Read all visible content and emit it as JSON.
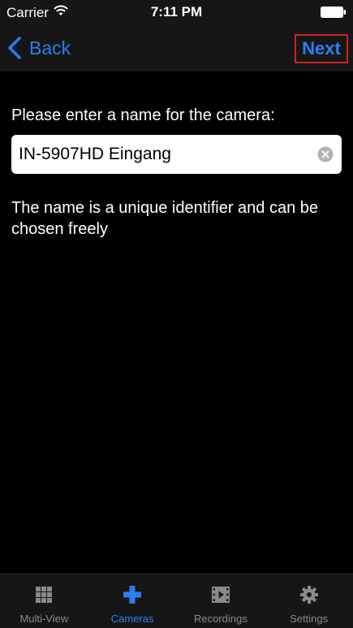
{
  "status_bar": {
    "carrier": "Carrier",
    "time": "7:11 PM"
  },
  "nav": {
    "back_label": "Back",
    "next_label": "Next"
  },
  "form": {
    "prompt": "Please enter a name for the camera:",
    "camera_name_value": "IN-5907HD Eingang",
    "helper_text": "The name is a unique identifier and can be chosen freely"
  },
  "tabs": [
    {
      "label": "Multi-View",
      "icon": "grid-icon",
      "active": false
    },
    {
      "label": "Cameras",
      "icon": "plus-icon",
      "active": true
    },
    {
      "label": "Recordings",
      "icon": "film-icon",
      "active": false
    },
    {
      "label": "Settings",
      "icon": "gear-icon",
      "active": false
    }
  ],
  "colors": {
    "accent": "#2a7ff0",
    "highlight_border": "#d21f26",
    "background": "#000000",
    "bar_background": "#161616",
    "inactive_tab": "#8a8a8a"
  }
}
